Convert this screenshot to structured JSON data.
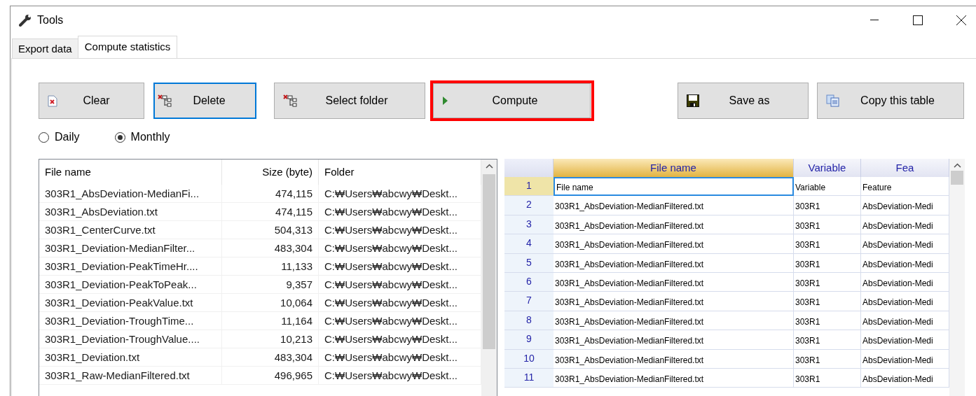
{
  "window": {
    "title": "Tools"
  },
  "tabs": [
    {
      "label": "Export data",
      "selected": false
    },
    {
      "label": "Compute statistics",
      "selected": true
    }
  ],
  "buttons": [
    {
      "label": "Clear",
      "kind": "clear",
      "focused": false,
      "highlighted": false
    },
    {
      "label": "Delete",
      "kind": "delete",
      "focused": true,
      "highlighted": false
    },
    {
      "label": "Select folder",
      "kind": "folder",
      "focused": false,
      "highlighted": false
    },
    {
      "label": "Compute",
      "kind": "compute",
      "focused": false,
      "highlighted": true
    },
    {
      "label": "Save as",
      "kind": "save",
      "focused": false,
      "highlighted": false
    },
    {
      "label": "Copy this table",
      "kind": "copy",
      "focused": false,
      "highlighted": false
    }
  ],
  "period_options": [
    {
      "label": "Daily",
      "selected": false
    },
    {
      "label": "Monthly",
      "selected": true
    }
  ],
  "file_list": {
    "columns": [
      "File name",
      "Size (byte)",
      "Folder"
    ],
    "rows": [
      [
        "303R1_AbsDeviation-MedianFi...",
        "474,115",
        "C:₩Users₩abcwy₩Deskt..."
      ],
      [
        "303R1_AbsDeviation.txt",
        "474,115",
        "C:₩Users₩abcwy₩Deskt..."
      ],
      [
        "303R1_CenterCurve.txt",
        "504,313",
        "C:₩Users₩abcwy₩Deskt..."
      ],
      [
        "303R1_Deviation-MedianFilter...",
        "483,304",
        "C:₩Users₩abcwy₩Deskt..."
      ],
      [
        "303R1_Deviation-PeakTimeHr....",
        "11,133",
        "C:₩Users₩abcwy₩Deskt..."
      ],
      [
        "303R1_Deviation-PeakToPeak...",
        "9,357",
        "C:₩Users₩abcwy₩Deskt..."
      ],
      [
        "303R1_Deviation-PeakValue.txt",
        "10,064",
        "C:₩Users₩abcwy₩Deskt..."
      ],
      [
        "303R1_Deviation-TroughTime...",
        "11,164",
        "C:₩Users₩abcwy₩Deskt..."
      ],
      [
        "303R1_Deviation-TroughValue....",
        "10,213",
        "C:₩Users₩abcwy₩Deskt..."
      ],
      [
        "303R1_Deviation.txt",
        "483,304",
        "C:₩Users₩abcwy₩Deskt..."
      ],
      [
        "303R1_Raw-MedianFiltered.txt",
        "496,965",
        "C:₩Users₩abcwy₩Deskt..."
      ]
    ]
  },
  "result_grid": {
    "columns": [
      {
        "label": "File name",
        "selected": true
      },
      {
        "label": "Variable",
        "selected": false
      },
      {
        "label": "Fea",
        "selected": false
      }
    ],
    "rows": [
      {
        "number": "1",
        "selected": true,
        "cells": [
          "File name",
          "Variable",
          "Feature"
        ]
      },
      {
        "number": "2",
        "selected": false,
        "cells": [
          "303R1_AbsDeviation-MedianFiltered.txt",
          "303R1",
          "AbsDeviation-Medi"
        ]
      },
      {
        "number": "3",
        "selected": false,
        "cells": [
          "303R1_AbsDeviation-MedianFiltered.txt",
          "303R1",
          "AbsDeviation-Medi"
        ]
      },
      {
        "number": "4",
        "selected": false,
        "cells": [
          "303R1_AbsDeviation-MedianFiltered.txt",
          "303R1",
          "AbsDeviation-Medi"
        ]
      },
      {
        "number": "5",
        "selected": false,
        "cells": [
          "303R1_AbsDeviation-MedianFiltered.txt",
          "303R1",
          "AbsDeviation-Medi"
        ]
      },
      {
        "number": "6",
        "selected": false,
        "cells": [
          "303R1_AbsDeviation-MedianFiltered.txt",
          "303R1",
          "AbsDeviation-Medi"
        ]
      },
      {
        "number": "7",
        "selected": false,
        "cells": [
          "303R1_AbsDeviation-MedianFiltered.txt",
          "303R1",
          "AbsDeviation-Medi"
        ]
      },
      {
        "number": "8",
        "selected": false,
        "cells": [
          "303R1_AbsDeviation-MedianFiltered.txt",
          "303R1",
          "AbsDeviation-Medi"
        ]
      },
      {
        "number": "9",
        "selected": false,
        "cells": [
          "303R1_AbsDeviation-MedianFiltered.txt",
          "303R1",
          "AbsDeviation-Medi"
        ]
      },
      {
        "number": "10",
        "selected": false,
        "cells": [
          "303R1_AbsDeviation-MedianFiltered.txt",
          "303R1",
          "AbsDeviation-Medi"
        ]
      },
      {
        "number": "11",
        "selected": false,
        "cells": [
          "303R1_AbsDeviation-MedianFiltered.txt",
          "303R1",
          "AbsDeviation-Medi"
        ]
      }
    ]
  }
}
